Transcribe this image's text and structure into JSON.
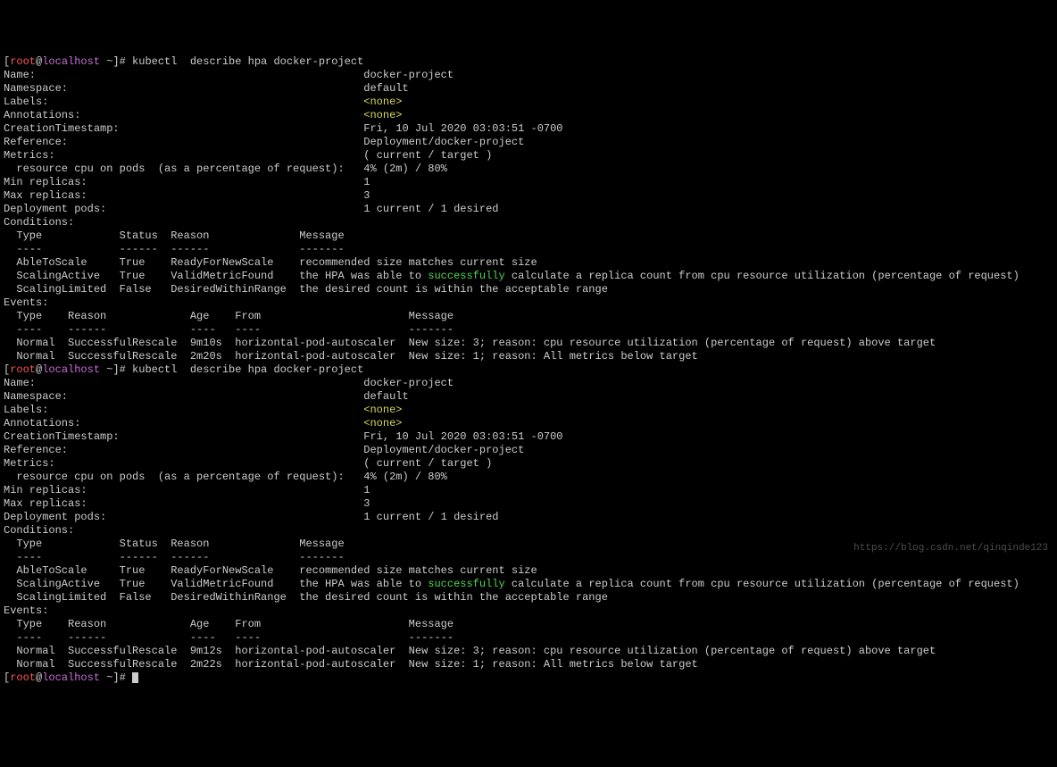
{
  "prompt": {
    "user": "root",
    "at": "@",
    "host": "localhost",
    "path": " ~",
    "end": "]# ",
    "cmd": "kubectl  describe hpa docker-project"
  },
  "fields": {
    "name_label": "Name:",
    "name_val": "docker-project",
    "namespace_label": "Namespace:",
    "namespace_val": "default",
    "labels_label": "Labels:",
    "labels_val": "<none>",
    "annotations_label": "Annotations:",
    "annotations_val": "<none>",
    "created_label": "CreationTimestamp:",
    "created_val": "Fri, 10 Jul 2020 03:03:51 -0700",
    "reference_label": "Reference:",
    "reference_val": "Deployment/docker-project",
    "metrics_label": "Metrics:",
    "metrics_val": "( current / target )",
    "cpu_label": "  resource cpu on pods  (as a percentage of request):",
    "cpu_val": "4% (2m) / 80%",
    "min_label": "Min replicas:",
    "min_val": "1",
    "max_label": "Max replicas:",
    "max_val": "3",
    "depl_label": "Deployment pods:",
    "depl_val": "1 current / 1 desired",
    "conditions": "Conditions:",
    "events": "Events:"
  },
  "cond_header": {
    "type": "Type",
    "status": "Status",
    "reason": "Reason",
    "message": "Message"
  },
  "cond_dash": {
    "type": "----",
    "status": "------",
    "reason": "------",
    "message": "-------"
  },
  "conditions": [
    {
      "type": "AbleToScale",
      "status": "True",
      "reason": "ReadyForNewScale",
      "message": "recommended size matches current size"
    },
    {
      "type": "ScalingActive",
      "status": "True",
      "reason": "ValidMetricFound",
      "msg_pre": "the HPA was able to ",
      "msg_green": "successfully",
      "msg_post": " calculate a replica count from cpu resource utilization (percentage of request)"
    },
    {
      "type": "ScalingLimited",
      "status": "False",
      "reason": "DesiredWithinRange",
      "message": "the desired count is within the acceptable range"
    }
  ],
  "events_header": {
    "type": "Type",
    "reason": "Reason",
    "age": "Age",
    "from": "From",
    "message": "Message"
  },
  "events_dash": {
    "type": "----",
    "reason": "------",
    "age": "----",
    "from": "----",
    "message": "-------"
  },
  "run1": {
    "events": [
      {
        "type": "Normal",
        "reason": "SuccessfulRescale",
        "age": "9m10s",
        "from": "horizontal-pod-autoscaler",
        "message": "New size: 3; reason: cpu resource utilization (percentage of request) above target"
      },
      {
        "type": "Normal",
        "reason": "SuccessfulRescale",
        "age": "2m20s",
        "from": "horizontal-pod-autoscaler",
        "message": "New size: 1; reason: All metrics below target"
      }
    ]
  },
  "run2": {
    "events": [
      {
        "type": "Normal",
        "reason": "SuccessfulRescale",
        "age": "9m12s",
        "from": "horizontal-pod-autoscaler",
        "message": "New size: 3; reason: cpu resource utilization (percentage of request) above target"
      },
      {
        "type": "Normal",
        "reason": "SuccessfulRescale",
        "age": "2m22s",
        "from": "horizontal-pod-autoscaler",
        "message": "New size: 1; reason: All metrics below target"
      }
    ]
  },
  "watermark": "https://blog.csdn.net/qinqinde123"
}
